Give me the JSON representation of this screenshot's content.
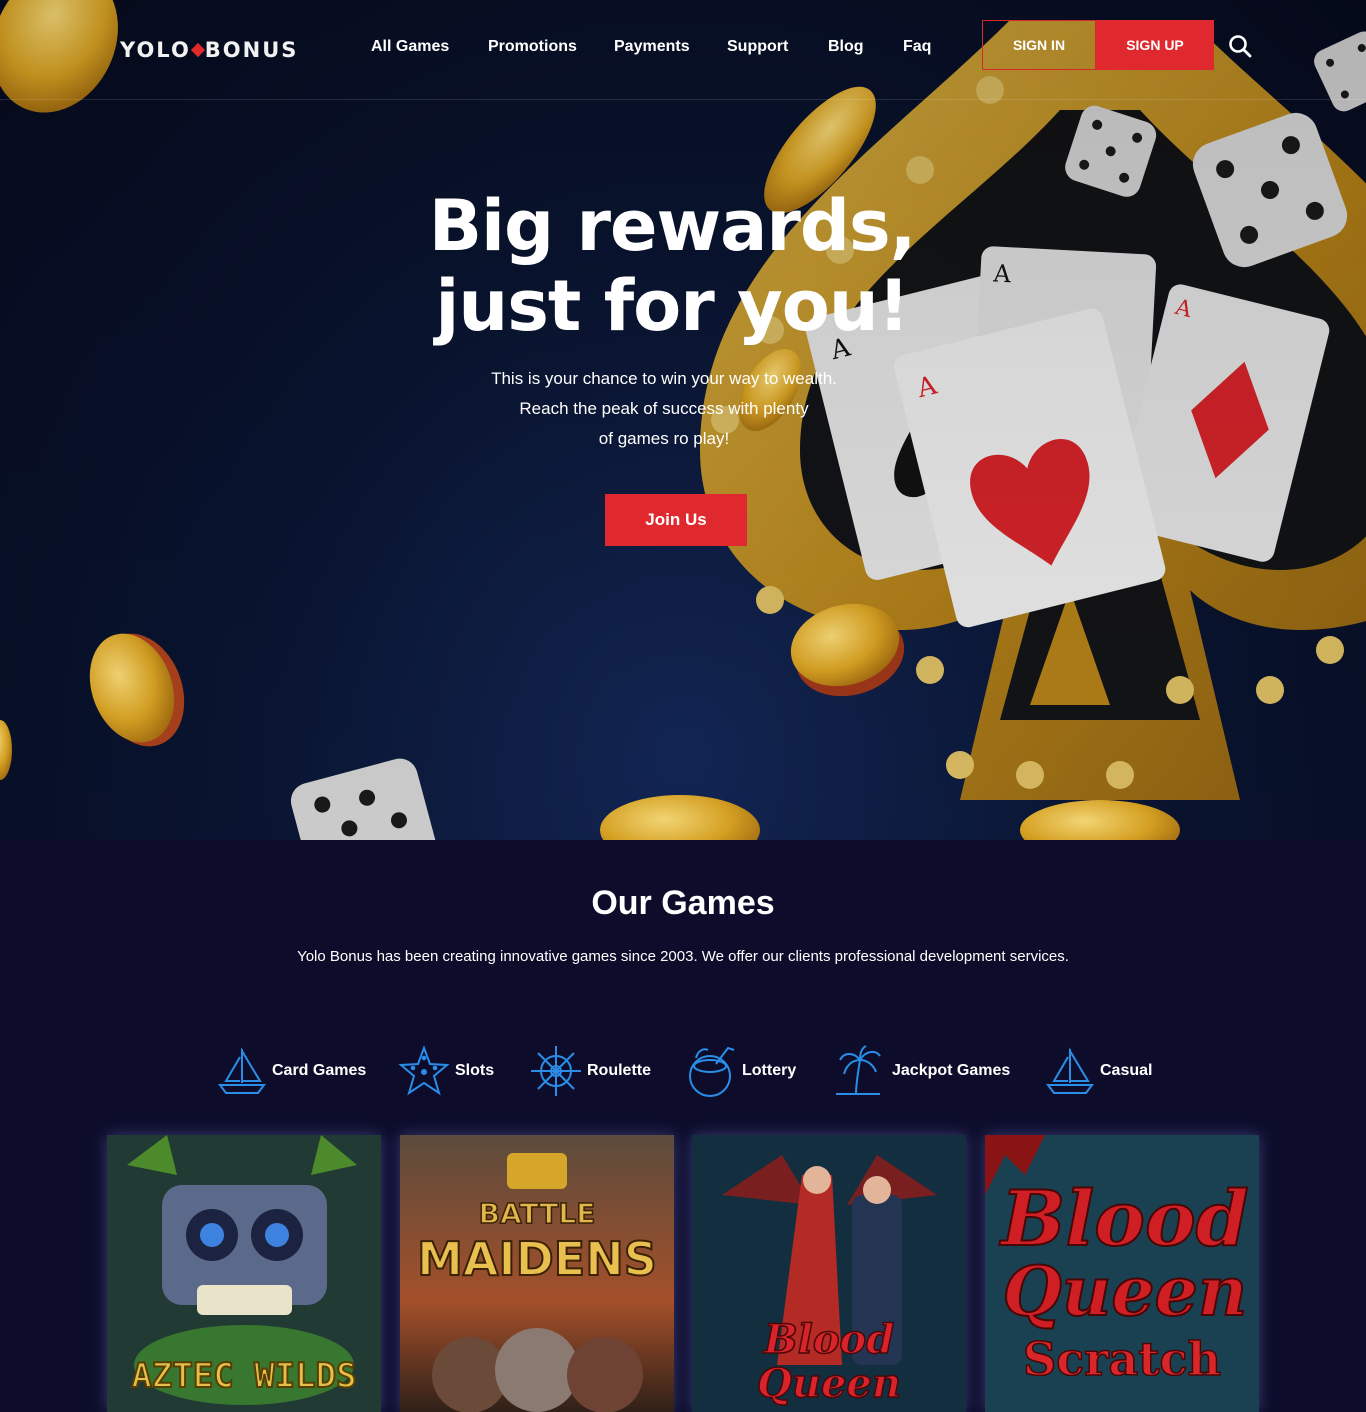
{
  "brand": {
    "logo_left": "YOLO",
    "logo_right": "BONUS"
  },
  "nav": {
    "links": [
      "All Games",
      "Promotions",
      "Payments",
      "Support",
      "Blog",
      "Faq"
    ],
    "sign_in": "SIGN IN",
    "sign_up": "SIGN UP",
    "search_icon": "search-icon"
  },
  "hero": {
    "title_line1": "Big rewards,",
    "title_line2": "just for you!",
    "sub_line1": "This is your chance to win your way to wealth.",
    "sub_line2": "Reach the peak of success with plenty",
    "sub_line3": "of games ro play!",
    "cta": "Join Us",
    "card_rank": "A"
  },
  "games": {
    "title": "Our Games",
    "description": "Yolo Bonus has been creating innovative games since 2003. We offer our clients professional development services.",
    "categories": [
      {
        "label": "Card Games",
        "icon": "sailboat-icon"
      },
      {
        "label": "Slots",
        "icon": "starfish-icon"
      },
      {
        "label": "Roulette",
        "icon": "ship-wheel-icon"
      },
      {
        "label": "Lottery",
        "icon": "coconut-drink-icon"
      },
      {
        "label": "Jackpot Games",
        "icon": "palm-tree-icon"
      },
      {
        "label": "Casual",
        "icon": "sailboat-icon"
      }
    ],
    "thumbnails": [
      {
        "title": "AZTEC WILDS"
      },
      {
        "title_line1": "BATTLE",
        "title_line2": "MAIDENS"
      },
      {
        "title_line1": "Blood",
        "title_line2": "Queen"
      },
      {
        "title_line1": "Blood",
        "title_line2": "Queen",
        "title_line3": "Scratch"
      }
    ]
  },
  "colors": {
    "accent": "#e0292f",
    "icon_blue": "#2a8ee8",
    "section_bg": "#0d0d2b",
    "gold": "#d9a520"
  }
}
